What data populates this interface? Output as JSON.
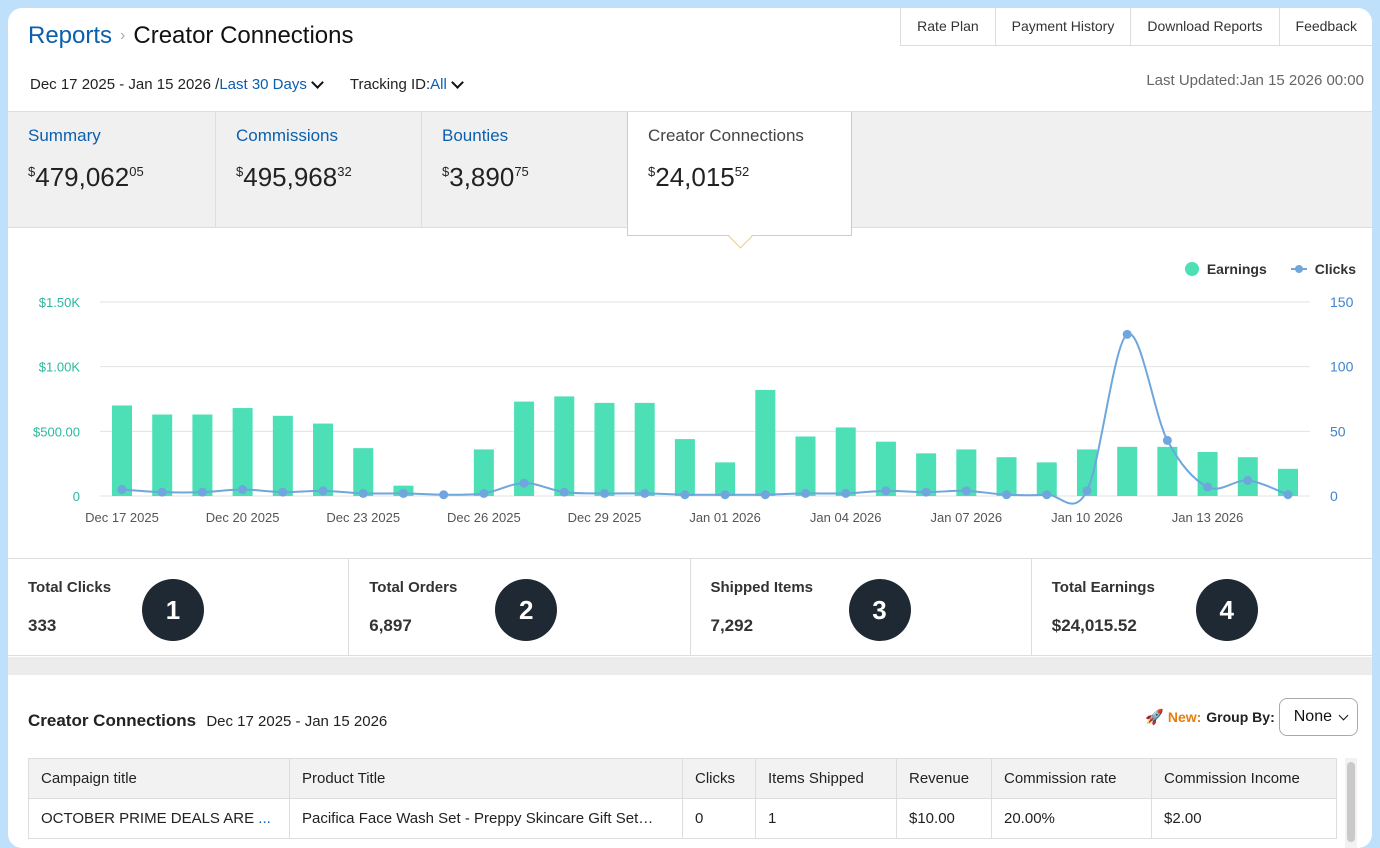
{
  "header": {
    "breadcrumb_root": "Reports",
    "breadcrumb_sep": "›",
    "page_title": "Creator Connections",
    "links": [
      "Rate Plan",
      "Payment History",
      "Download Reports",
      "Feedback"
    ]
  },
  "filters": {
    "date_range": "Dec 17 2025 - Jan 15 2026 /",
    "period": "Last 30 Days",
    "tracking_label": "Tracking ID:",
    "tracking_value": "All",
    "last_updated": "Last Updated:Jan 15 2026 00:00"
  },
  "tabs": [
    {
      "name": "Summary",
      "dollars": "479,062",
      "cents": "05"
    },
    {
      "name": "Commissions",
      "dollars": "495,968",
      "cents": "32"
    },
    {
      "name": "Bounties",
      "dollars": "3,890",
      "cents": "75"
    },
    {
      "name": "Creator Connections",
      "dollars": "24,015",
      "cents": "52"
    }
  ],
  "currency_symbol": "$",
  "chart_data": {
    "type": "bar",
    "legend": [
      "Earnings",
      "Clicks"
    ],
    "legend_position": "top-right",
    "x_tick_labels": [
      "Dec 17 2025",
      "Dec 20 2025",
      "Dec 23 2025",
      "Dec 26 2025",
      "Dec 29 2025",
      "Jan 01 2026",
      "Jan 04 2026",
      "Jan 07 2026",
      "Jan 10 2026",
      "Jan 13 2026"
    ],
    "y_left_ticks": [
      "0",
      "$500.00",
      "$1.00K",
      "$1.50K"
    ],
    "y_right_ticks": [
      "0",
      "50",
      "100",
      "150"
    ],
    "y_left_range": [
      0,
      1500
    ],
    "y_right_range": [
      0,
      150
    ],
    "grid": true,
    "earnings": [
      700,
      630,
      630,
      680,
      620,
      560,
      370,
      80,
      0,
      360,
      730,
      770,
      720,
      720,
      440,
      260,
      820,
      460,
      530,
      420,
      330,
      360,
      300,
      260,
      360,
      380,
      380,
      340,
      300,
      210
    ],
    "clicks": [
      5,
      3,
      3,
      5,
      3,
      4,
      2,
      2,
      1,
      2,
      10,
      3,
      2,
      2,
      1,
      1,
      1,
      2,
      2,
      4,
      3,
      4,
      1,
      1,
      4,
      125,
      43,
      7,
      12,
      1
    ],
    "colors": {
      "earnings": "#4ddfb6",
      "clicks": "#6fa6dd",
      "left_axis": "#2bb8a0",
      "right_axis": "#3f84cc"
    }
  },
  "stats": [
    {
      "label": "Total Clicks",
      "value": "333",
      "badge": "1"
    },
    {
      "label": "Total Orders",
      "value": "6,897",
      "badge": "2"
    },
    {
      "label": "Shipped Items",
      "value": "7,292",
      "badge": "3"
    },
    {
      "label": "Total Earnings",
      "value": "$24,015.52",
      "badge": "4"
    }
  ],
  "table_section": {
    "title": "Creator Connections",
    "date_range": "Dec 17 2025 - Jan 15 2026",
    "new_label": "New:",
    "group_by_label": "Group By:",
    "group_by_value": "None"
  },
  "table": {
    "headers": [
      "Campaign title",
      "Product Title",
      "Clicks",
      "Items Shipped",
      "Revenue",
      "Commission rate",
      "Commission Income"
    ],
    "rows": [
      [
        "OCTOBER PRIME DEALS ARE",
        "Pacifica Face Wash Set - Preppy Skincare Gift Set…",
        "0",
        "1",
        "$10.00",
        "20.00%",
        "$2.00"
      ]
    ],
    "ellipsis": "..."
  }
}
